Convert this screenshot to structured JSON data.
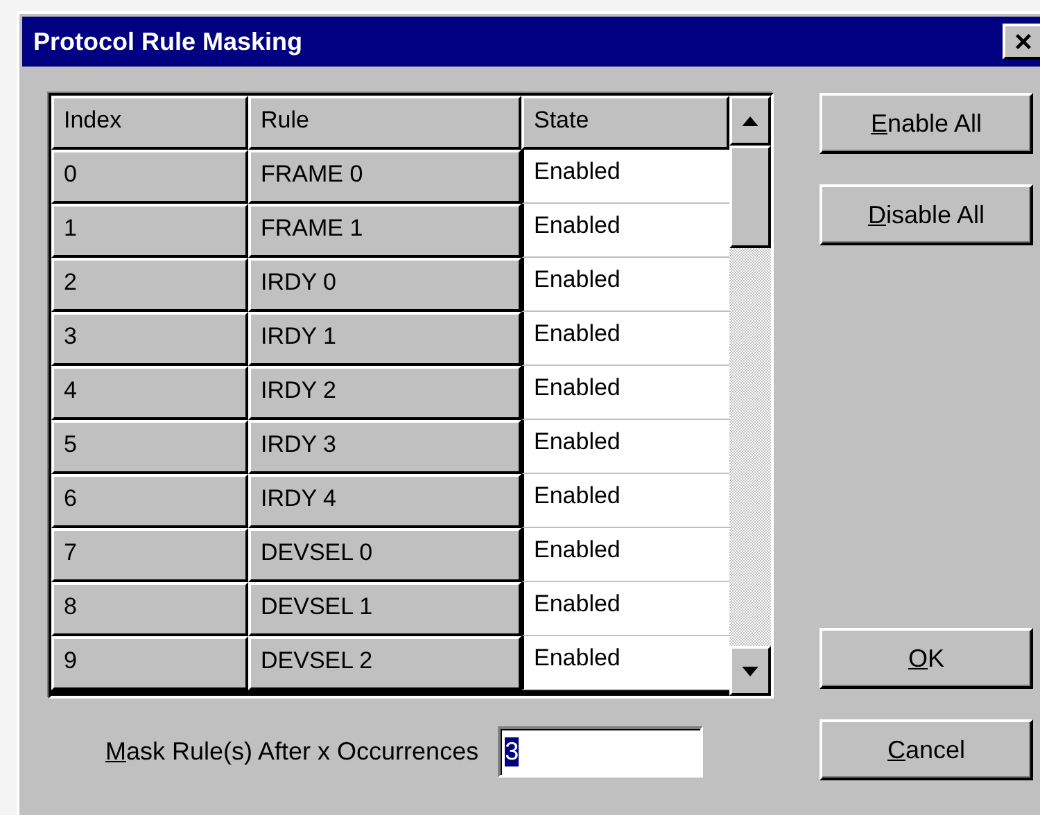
{
  "window": {
    "title": "Protocol Rule Masking"
  },
  "table": {
    "columns": [
      "Index",
      "Rule",
      "State"
    ],
    "rows": [
      {
        "index": "0",
        "rule": "FRAME 0",
        "state": "Enabled"
      },
      {
        "index": "1",
        "rule": "FRAME 1",
        "state": "Enabled"
      },
      {
        "index": "2",
        "rule": "IRDY 0",
        "state": "Enabled"
      },
      {
        "index": "3",
        "rule": "IRDY 1",
        "state": "Enabled"
      },
      {
        "index": "4",
        "rule": "IRDY 2",
        "state": "Enabled"
      },
      {
        "index": "5",
        "rule": "IRDY 3",
        "state": "Enabled"
      },
      {
        "index": "6",
        "rule": "IRDY 4",
        "state": "Enabled"
      },
      {
        "index": "7",
        "rule": "DEVSEL 0",
        "state": "Enabled"
      },
      {
        "index": "8",
        "rule": "DEVSEL 1",
        "state": "Enabled"
      },
      {
        "index": "9",
        "rule": "DEVSEL 2",
        "state": "Enabled"
      }
    ]
  },
  "side_buttons": [
    {
      "label": "Enable All",
      "underline_first": true
    },
    {
      "label": "Disable All",
      "underline_first": true
    }
  ],
  "occurrences": {
    "label": "Mask Rule(s) After x Occurrences",
    "underline_first": true,
    "value": "3",
    "value_selected": true
  },
  "bottom_buttons": [
    {
      "label": "OK",
      "underline_first": true
    },
    {
      "label": "Cancel",
      "underline_first": true
    }
  ]
}
